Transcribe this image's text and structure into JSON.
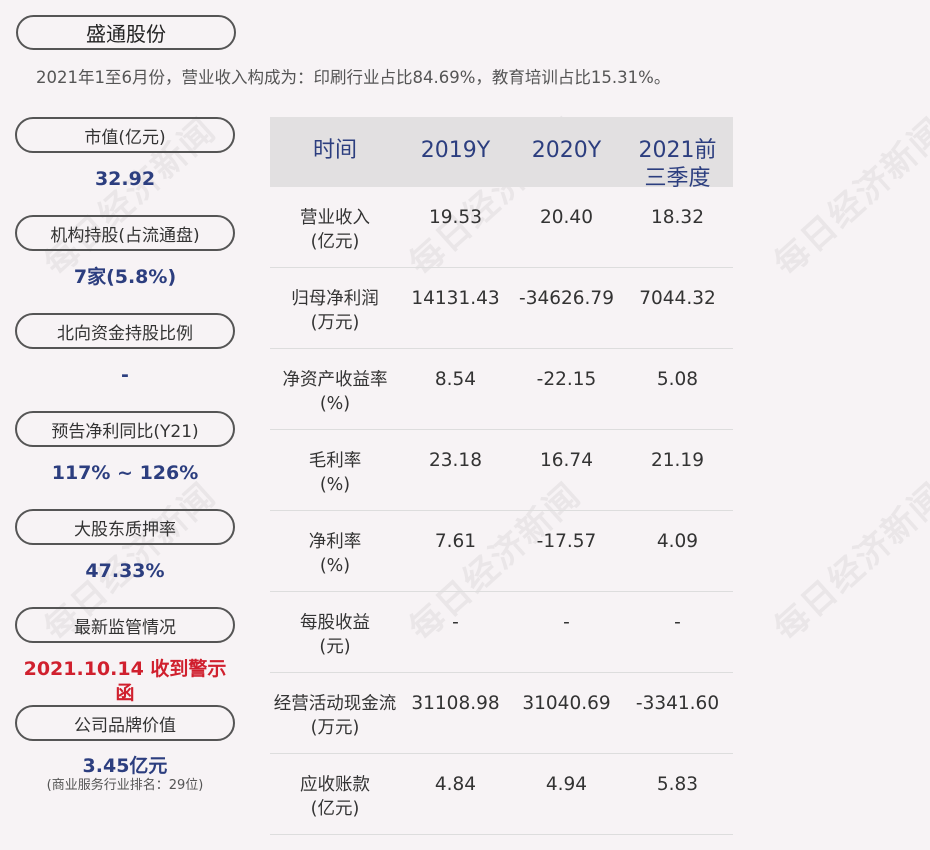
{
  "watermark": "每日经济新闻",
  "company": "盛通股份",
  "summary": "2021年1至6月份，营业收入构成为：印刷行业占比84.69%，教育培训占比15.31%。",
  "metrics": [
    {
      "label": "市值(亿元)",
      "value": "32.92"
    },
    {
      "label": "机构持股(占流通盘)",
      "value": "7家(5.8%)"
    },
    {
      "label": "北向资金持股比例",
      "value": "-"
    },
    {
      "label": "预告净利同比(Y21)",
      "value": "117% ~ 126%"
    },
    {
      "label": "大股东质押率",
      "value": "47.33%"
    },
    {
      "label": "最新监管情况",
      "value": "2021.10.14 收到警示函",
      "color": "#d0202e"
    },
    {
      "label": "公司品牌价值",
      "value": "3.45亿元",
      "note": "(商业服务行业排名：29位)"
    }
  ],
  "table": {
    "headers": [
      "时间",
      "2019Y",
      "2020Y",
      "2021前三季度"
    ],
    "rows": [
      {
        "label": "营业收入\n(亿元)",
        "values": [
          "19.53",
          "20.40",
          "18.32"
        ]
      },
      {
        "label": "归母净利润\n(万元)",
        "values": [
          "14131.43",
          "-34626.79",
          "7044.32"
        ]
      },
      {
        "label": "净资产收益率\n(%)",
        "values": [
          "8.54",
          "-22.15",
          "5.08"
        ]
      },
      {
        "label": "毛利率\n(%)",
        "values": [
          "23.18",
          "16.74",
          "21.19"
        ]
      },
      {
        "label": "净利率\n(%)",
        "values": [
          "7.61",
          "-17.57",
          "4.09"
        ]
      },
      {
        "label": "每股收益\n(元)",
        "values": [
          "-",
          "-",
          "-"
        ]
      },
      {
        "label": "经营活动现金流\n(万元)",
        "values": [
          "31108.98",
          "31040.69",
          "-3341.60"
        ]
      },
      {
        "label": "应收账款\n(亿元)",
        "values": [
          "4.84",
          "4.94",
          "5.83"
        ]
      }
    ]
  },
  "colors": {
    "value": "#2c3e7f",
    "alert": "#d0202e",
    "header_bg": "#e2e0e1",
    "page_bg": "#f7f3f5"
  }
}
